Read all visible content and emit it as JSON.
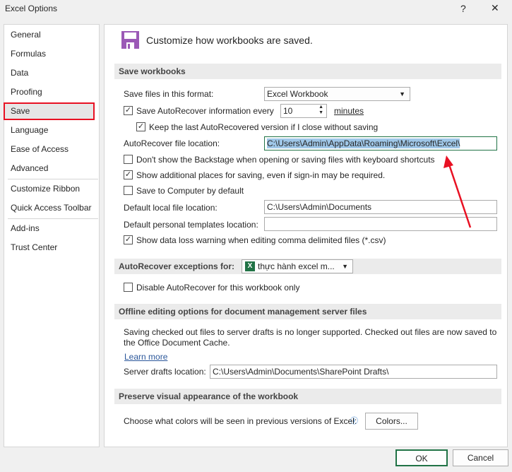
{
  "window": {
    "title": "Excel Options",
    "help": "?",
    "close": "✕"
  },
  "sidebar": {
    "items": [
      {
        "label": "General"
      },
      {
        "label": "Formulas"
      },
      {
        "label": "Data"
      },
      {
        "label": "Proofing"
      },
      {
        "label": "Save"
      },
      {
        "label": "Language"
      },
      {
        "label": "Ease of Access"
      },
      {
        "label": "Advanced"
      },
      {
        "label": "Customize Ribbon"
      },
      {
        "label": "Quick Access Toolbar"
      },
      {
        "label": "Add-ins"
      },
      {
        "label": "Trust Center"
      }
    ],
    "selected": "Save",
    "highlight_color": "#e81123"
  },
  "main": {
    "heading": "Customize how workbooks are saved.",
    "icon_color": "#9b59b6",
    "save_workbooks": {
      "title": "Save workbooks",
      "format_label": "Save files in this format:",
      "format_value": "Excel Workbook",
      "autorecover_label": "Save AutoRecover information every",
      "autorecover_checked": true,
      "autorecover_minutes": "10",
      "minutes_label": "minutes",
      "keep_label": "Keep the last AutoRecovered version if I close without saving",
      "keep_checked": true,
      "location_label": "AutoRecover file location:",
      "location_value": "C:\\Users\\Admin\\AppData\\Roaming\\Microsoft\\Excel\\",
      "backstage_label": "Don't show the Backstage when opening or saving files with keyboard shortcuts",
      "backstage_checked": false,
      "additional_label": "Show additional places for saving, even if sign-in may be required.",
      "additional_checked": true,
      "computer_label": "Save to Computer by default",
      "computer_checked": false,
      "local_label": "Default local file location:",
      "local_value": "C:\\Users\\Admin\\Documents",
      "templates_label": "Default personal templates location:",
      "templates_value": "",
      "csv_label": "Show data loss warning when editing comma delimited files (*.csv)",
      "csv_checked": true
    },
    "exceptions": {
      "title": "AutoRecover exceptions for:",
      "workbook": "thực hành excel m...",
      "disable_label": "Disable AutoRecover for this workbook only",
      "disable_checked": false
    },
    "offline": {
      "title": "Offline editing options for document management server files",
      "text": "Saving checked out files to server drafts is no longer supported. Checked out files are now saved to the Office Document Cache.",
      "learn_more": "Learn more",
      "drafts_label": "Server drafts location:",
      "drafts_value": "C:\\Users\\Admin\\Documents\\SharePoint Drafts\\"
    },
    "preserve": {
      "title": "Preserve visual appearance of the workbook",
      "colors_label": "Choose what colors will be seen in previous versions of Excel:",
      "colors_button": "Colors..."
    }
  },
  "footer": {
    "ok": "OK",
    "cancel": "Cancel"
  }
}
